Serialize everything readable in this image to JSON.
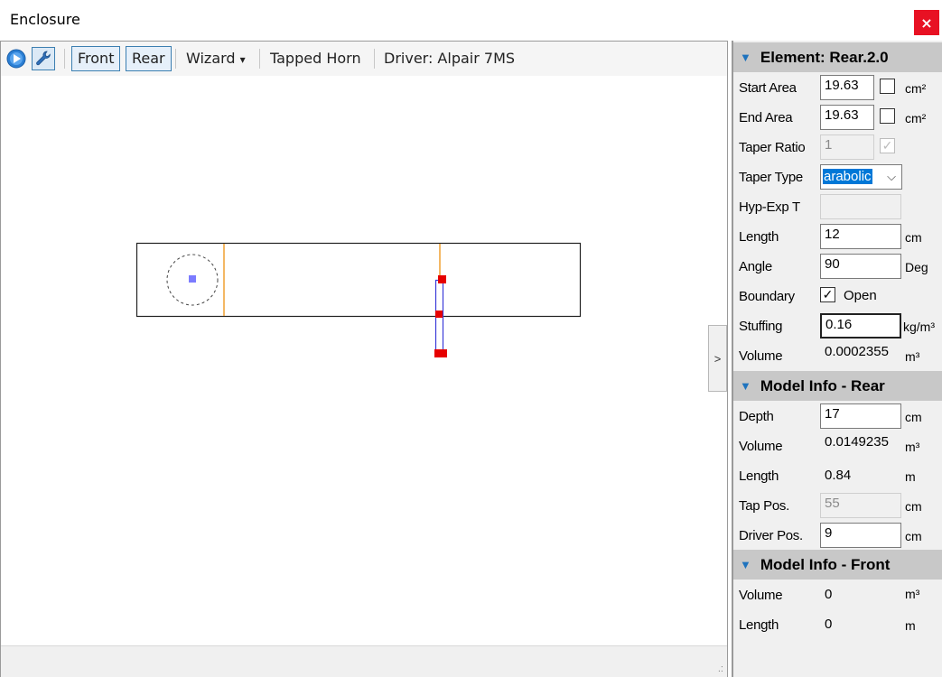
{
  "window": {
    "title": "Enclosure",
    "close_label": "×"
  },
  "toolbar": {
    "play_icon": "play-icon",
    "settings_icon": "wrench-icon",
    "front_label": "Front",
    "rear_label": "Rear",
    "wizard_label": "Wizard",
    "wizard_caret": "▾",
    "tapped_horn_label": "Tapped Horn",
    "driver_label": "Driver: Alpair 7MS"
  },
  "colors": {
    "accent": "#1e73be",
    "close": "#e81123",
    "handle": "#e60000",
    "line_orange": "#f0a030",
    "blue_rect": "#3a3ad8"
  },
  "collapse_label": ">",
  "element_section": {
    "title": "Element: Rear.2.0",
    "start_area": {
      "label": "Start Area",
      "value": "19.63",
      "unit": "cm²"
    },
    "end_area": {
      "label": "End Area",
      "value": "19.63",
      "unit": "cm²"
    },
    "taper_ratio": {
      "label": "Taper Ratio",
      "value": "1"
    },
    "taper_type": {
      "label": "Taper Type",
      "value": "arabolic",
      "caret": "⌵"
    },
    "hyp_exp": {
      "label": "Hyp-Exp T",
      "value": ""
    },
    "length": {
      "label": "Length",
      "value": "12",
      "unit": "cm"
    },
    "angle": {
      "label": "Angle",
      "value": "90",
      "unit": "Deg"
    },
    "boundary": {
      "label": "Boundary",
      "checkbox_label": "Open",
      "checked": true,
      "check_glyph": "✓"
    },
    "stuffing": {
      "label": "Stuffing",
      "value": "0.16",
      "unit": "kg/m³"
    },
    "volume": {
      "label": "Volume",
      "value": "0.0002355",
      "unit": "m³"
    }
  },
  "model_rear": {
    "title": "Model Info - Rear",
    "depth": {
      "label": "Depth",
      "value": "17",
      "unit": "cm"
    },
    "volume": {
      "label": "Volume",
      "value": "0.0149235",
      "unit": "m³"
    },
    "length": {
      "label": "Length",
      "value": "0.84",
      "unit": "m"
    },
    "tap_pos": {
      "label": "Tap Pos.",
      "value": "55",
      "unit": "cm"
    },
    "driver_pos": {
      "label": "Driver Pos.",
      "value": "9",
      "unit": "cm"
    }
  },
  "model_front": {
    "title": "Model Info - Front",
    "volume": {
      "label": "Volume",
      "value": "0",
      "unit": "m³"
    },
    "length": {
      "label": "Length",
      "value": "0",
      "unit": "m"
    }
  },
  "status": {
    "grip": ".:"
  }
}
